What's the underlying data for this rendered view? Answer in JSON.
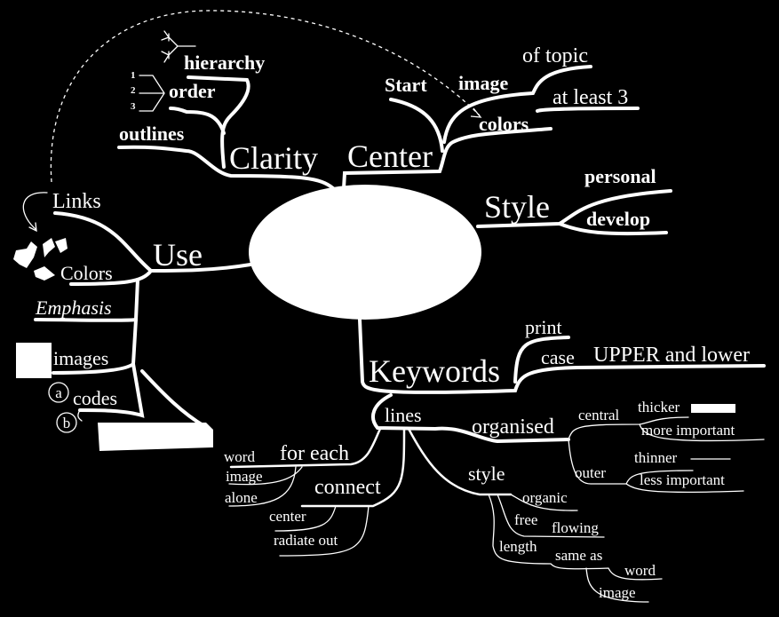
{
  "colors": {
    "background": "#000000",
    "foreground": "#ffffff"
  },
  "branches": {
    "clarity": {
      "label": "Clarity",
      "children": [
        "hierarchy",
        "order",
        "outlines"
      ],
      "order_numbers": [
        "1",
        "2",
        "3"
      ]
    },
    "center": {
      "label": "Center",
      "children": {
        "start": "Start",
        "image": "image",
        "of_topic": "of topic",
        "colors": "colors",
        "at_least": "at least 3"
      }
    },
    "style": {
      "label": "Style",
      "children": [
        "personal",
        "develop"
      ]
    },
    "use": {
      "label": "Use",
      "children": {
        "links": "Links",
        "colors": "Colors",
        "emphasis": "Emphasis",
        "images": "images",
        "codes": "codes",
        "code_a": "a",
        "code_b": "b"
      }
    },
    "keywords": {
      "label": "Keywords",
      "children": {
        "print": "print",
        "case": "case",
        "case_value": "UPPER and lower"
      }
    },
    "lines": {
      "label": "lines",
      "organised": {
        "label": "organised",
        "central": "central",
        "thicker": "thicker",
        "more_important": "more important",
        "outer": "outer",
        "thinner": "thinner",
        "less_important": "less important"
      },
      "style": {
        "label": "style",
        "organic": "organic",
        "free": "free",
        "flowing": "flowing",
        "length": "length",
        "same_as": "same as",
        "word": "word",
        "image": "image"
      },
      "for_each": {
        "label": "for each",
        "word": "word",
        "image": "image",
        "alone": "alone"
      },
      "connect": {
        "label": "connect",
        "center": "center",
        "radiate_out": "radiate out"
      }
    }
  }
}
